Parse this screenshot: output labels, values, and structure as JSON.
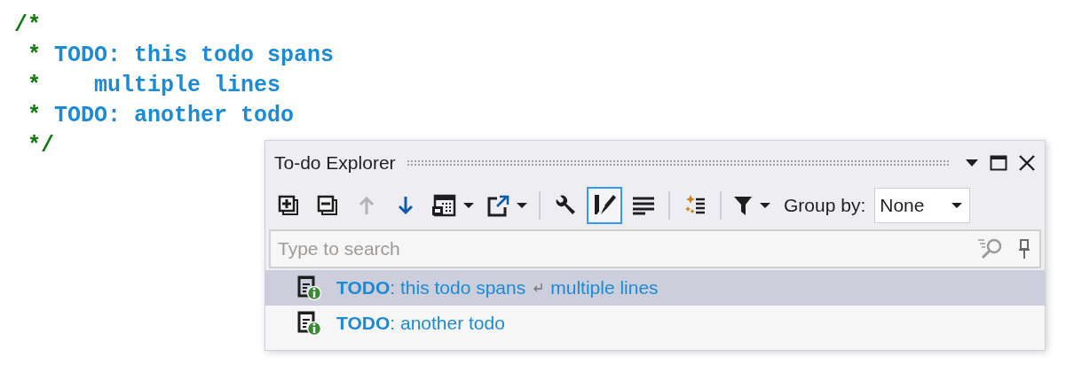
{
  "code": {
    "lines": [
      [
        {
          "kind": "comment",
          "text": "/*"
        }
      ],
      [
        {
          "kind": "comment",
          "text": " * "
        },
        {
          "kind": "todo",
          "text": "TODO: this todo spans"
        }
      ],
      [
        {
          "kind": "comment",
          "text": " *    "
        },
        {
          "kind": "todo",
          "text": "multiple lines"
        }
      ],
      [
        {
          "kind": "comment",
          "text": " * "
        },
        {
          "kind": "todo",
          "text": "TODO: another todo"
        }
      ],
      [
        {
          "kind": "comment",
          "text": " */"
        }
      ]
    ]
  },
  "panel": {
    "title": "To-do Explorer",
    "toolbar": {
      "groups": [
        [
          {
            "disabled": false,
            "selected": false,
            "dropdown": false
          },
          {
            "disabled": false,
            "selected": false,
            "dropdown": false
          },
          {
            "disabled": true,
            "selected": false,
            "dropdown": false
          },
          {
            "disabled": false,
            "selected": false,
            "dropdown": false
          },
          {
            "disabled": false,
            "selected": false,
            "dropdown": true
          },
          {
            "disabled": false,
            "selected": false,
            "dropdown": true
          }
        ],
        [
          {
            "disabled": false,
            "selected": false,
            "dropdown": false
          },
          {
            "disabled": false,
            "selected": true,
            "dropdown": false
          },
          {
            "disabled": false,
            "selected": false,
            "dropdown": false
          }
        ],
        [
          {
            "disabled": false,
            "selected": false,
            "dropdown": false
          }
        ],
        [
          {
            "disabled": false,
            "selected": false,
            "dropdown": true
          }
        ]
      ],
      "group_by": {
        "label": "Group by:",
        "value": "None"
      }
    },
    "search": {
      "placeholder": "Type to search"
    },
    "items": [
      {
        "text": "**TODO**: this todo spans",
        "continuation": "multiple lines",
        "selected": true
      },
      {
        "text": "**TODO**: another todo",
        "selected": false
      }
    ]
  }
}
